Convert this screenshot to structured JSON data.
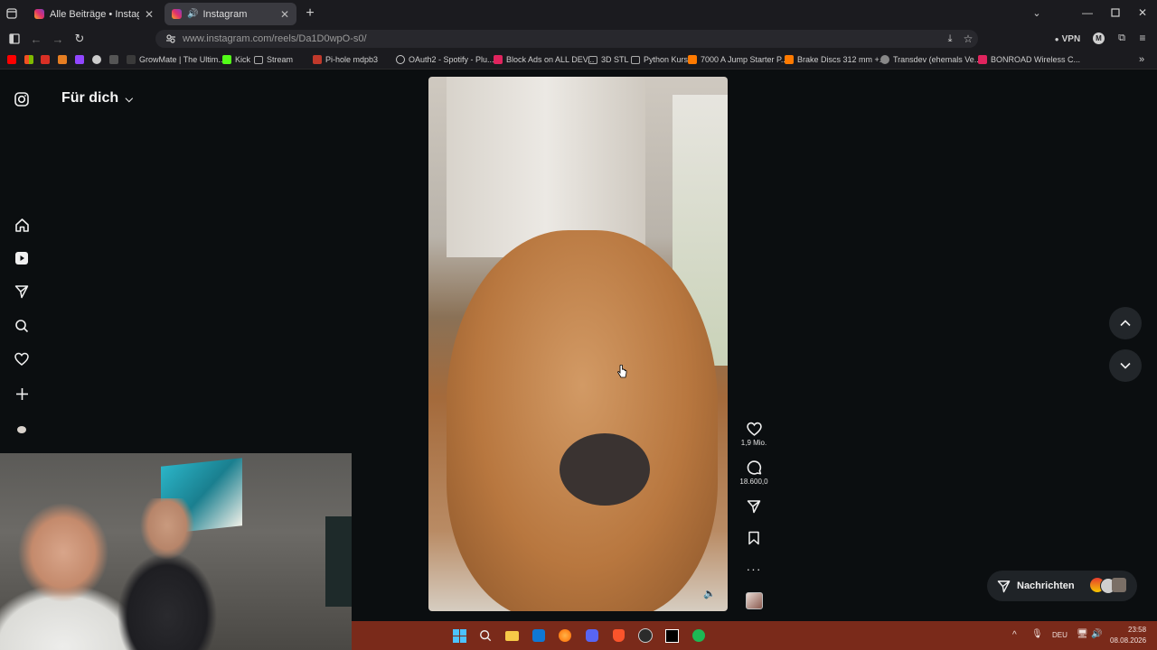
{
  "browser": {
    "tabs": [
      {
        "label": "Alle Beiträge • Instagram",
        "active": false
      },
      {
        "label": "Instagram",
        "active": true
      }
    ],
    "url": "www.instagram.com/reels/Da1D0wpO-s0/",
    "vpn_label": "VPN",
    "bookmarks": [
      {
        "label": "GrowMate | The Ultim...",
        "color": "#3a3a3a"
      },
      {
        "label": "Kick",
        "color": "#53fc18"
      },
      {
        "label": "Stream",
        "color": "#888888"
      },
      {
        "label": "Pi-hole mdpb3",
        "color": "#c0392b"
      },
      {
        "label": "OAuth2 - Spotify - Plu...",
        "color": "#777777"
      },
      {
        "label": "Block Ads on ALL DEV...",
        "color": "#e0245e"
      },
      {
        "label": "3D STL",
        "color": "#888888"
      },
      {
        "label": "Python Kurs",
        "color": "#888888"
      },
      {
        "label": "7000 A Jump Starter P...",
        "color": "#ff7a00"
      },
      {
        "label": "Brake Discs 312 mm +...",
        "color": "#ff7a00"
      },
      {
        "label": "Transdev (ehemals Ve...",
        "color": "#888888"
      },
      {
        "label": "BONROAD Wireless C...",
        "color": "#e0245e"
      }
    ]
  },
  "instagram": {
    "feed_title": "Für dich",
    "actions": {
      "likes": "1,9 Mio.",
      "comments": "18.600,0"
    },
    "messages_label": "Nachrichten"
  },
  "system": {
    "language": "DEU",
    "time": "23:58",
    "date": "08.08.2026",
    "accent": "#7a2a1a"
  }
}
